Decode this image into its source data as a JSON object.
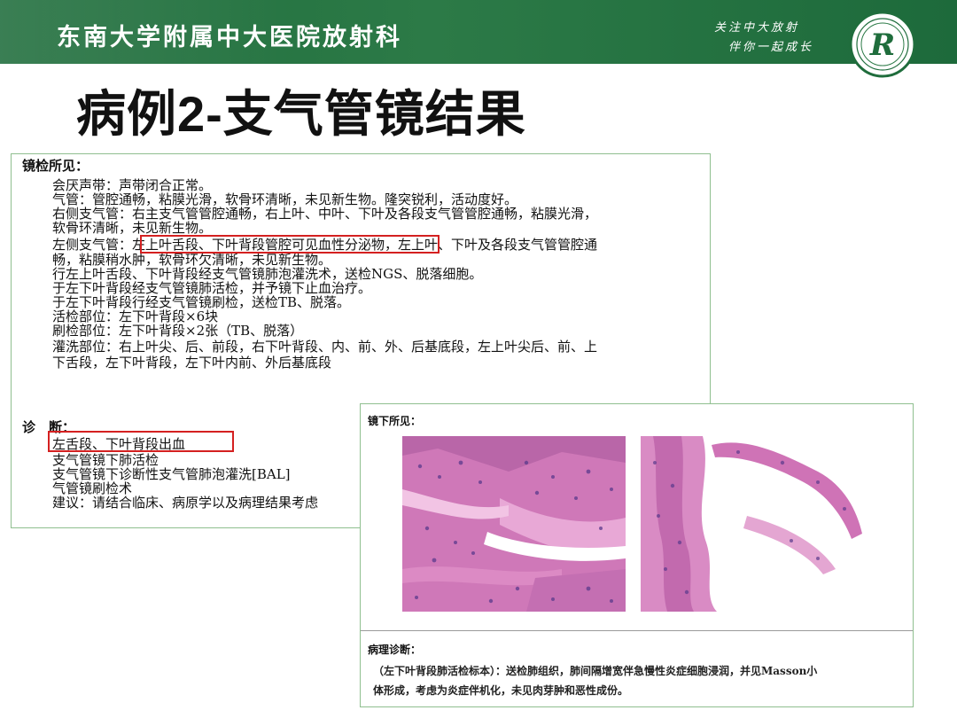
{
  "header": {
    "hospital": "东南大学附属中大医院放射科",
    "slogan_line1": "关注中大放射",
    "slogan_line2": "伴你一起成长",
    "logo_letter": "R"
  },
  "slide_title": "病例2-支气管镜结果",
  "report": {
    "findings_heading": "镜检所见：",
    "findings_lines": [
      "会厌声带：声带闭合正常。",
      "气管：管腔通畅，粘膜光滑，软骨环清晰，未见新生物。隆突锐利，活动度好。",
      "右侧支气管：右主支气管管腔通畅，右上叶、中叶、下叶及各段支气管管腔通畅，粘膜光滑，",
      "软骨环清晰，未见新生物。",
      "左侧支气管：左上叶舌段、下叶背段管腔可见血性分泌物，左上叶、下叶及各段支气管管腔通",
      "畅，粘膜稍水肿，软骨环欠清晰，未见新生物。",
      "行左上叶舌段、下叶背段经支气管镜肺泡灌洗术，送检NGS、脱落细胞。",
      "于左下叶背段经支气管镜肺活检，并予镜下止血治疗。",
      "于左下叶背段行经支气管镜刷检，送检TB、脱落。",
      "活检部位：左下叶背段×6块",
      "刷检部位：左下叶背段×2张（TB、脱落）",
      "灌洗部位：右上叶尖、后、前段，右下叶背段、内、前、外、后基底段，左上叶尖后、前、上",
      "下舌段，左下叶背段，左下叶内前、外后基底段"
    ],
    "diagnosis_heading": "诊　断：",
    "diagnosis_lines": [
      "左舌段、下叶背段出血",
      "支气管镜下肺活检",
      "支气管镜下诊断性支气管肺泡灌洗[BAL]",
      "气管镜刷检术",
      "建议：请结合临床、病原学以及病理结果考虑"
    ]
  },
  "pathology": {
    "microscope_heading": "镜下所见：",
    "diagnosis_heading": "病理诊断：",
    "diagnosis_line1": "（左下叶背段肺活检标本）：送检肺组织，肺间隔增宽伴急慢性炎症细胞浸润，并见Masson小",
    "diagnosis_line2": "体形成，考虑为炎症伴机化，未见肉芽肿和恶性成份。"
  },
  "colors": {
    "banner_green": "#1f6d3c",
    "panel_border": "#8fbf8f",
    "highlight_red": "#d42020",
    "he_pink": "#d77fbe",
    "he_nuclei": "#5a3a8c"
  }
}
